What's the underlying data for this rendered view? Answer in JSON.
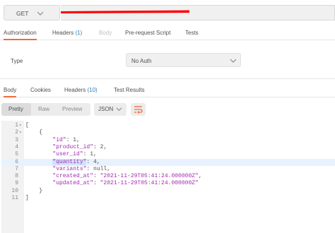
{
  "request": {
    "method": "GET",
    "url_redaction_color": "#ff0000"
  },
  "request_tabs": [
    {
      "label": "Authorization",
      "count": "",
      "state": "active"
    },
    {
      "label": "Headers",
      "count": "(1)",
      "state": "normal"
    },
    {
      "label": "Body",
      "count": "",
      "state": "disabled"
    },
    {
      "label": "Pre-request Script",
      "count": "",
      "state": "normal"
    },
    {
      "label": "Tests",
      "count": "",
      "state": "normal"
    }
  ],
  "auth": {
    "type_label": "Type",
    "type_value": "No Auth"
  },
  "response_tabs": [
    {
      "label": "Body",
      "count": "",
      "state": "active"
    },
    {
      "label": "Cookies",
      "count": "",
      "state": "normal"
    },
    {
      "label": "Headers",
      "count": "(10)",
      "state": "normal"
    },
    {
      "label": "Test Results",
      "count": "",
      "state": "normal"
    }
  ],
  "format": {
    "options": [
      "Pretty",
      "Raw",
      "Preview"
    ],
    "selected": "Pretty",
    "language": "JSON",
    "wrap_icon": "wrap-lines-icon"
  },
  "code_lines": [
    {
      "n": "1",
      "fold": "▾",
      "text": "["
    },
    {
      "n": "2",
      "fold": "▾",
      "text": "    {"
    },
    {
      "n": "3",
      "fold": "",
      "key": "\"id\"",
      "val": "1",
      "val_type": "num",
      "comma": true
    },
    {
      "n": "4",
      "fold": "",
      "key": "\"product_id\"",
      "val": "2",
      "val_type": "num",
      "comma": true
    },
    {
      "n": "5",
      "fold": "",
      "key": "\"user_id\"",
      "val": "1",
      "val_type": "num",
      "comma": true
    },
    {
      "n": "6",
      "fold": "",
      "key": "\"quantity\"",
      "val": "4",
      "val_type": "num",
      "comma": true,
      "highlight": true
    },
    {
      "n": "7",
      "fold": "",
      "key": "\"variants\"",
      "val": "null",
      "val_type": "num",
      "comma": true
    },
    {
      "n": "8",
      "fold": "",
      "key": "\"created_at\"",
      "val": "\"2021-11-29T05:41:24.000000Z\"",
      "val_type": "str",
      "comma": true
    },
    {
      "n": "9",
      "fold": "",
      "key": "\"updated_at\"",
      "val": "\"2021-11-29T05:41:24.000000Z\"",
      "val_type": "str",
      "comma": false
    },
    {
      "n": "10",
      "fold": "",
      "text": "    }"
    },
    {
      "n": "11",
      "fold": "",
      "text": "]"
    }
  ],
  "colors": {
    "accent": "#f26b3a",
    "count_blue": "#2f7fb8",
    "json_key": "#a32caf",
    "highlight_line": "#e8f2ff"
  }
}
